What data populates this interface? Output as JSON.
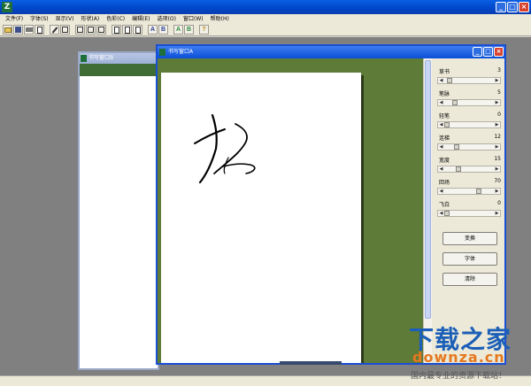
{
  "app": {
    "icon_glyph": "Z",
    "window_buttons": [
      "_",
      "□",
      "×"
    ]
  },
  "menu": [
    "文件(F)",
    "字体(S)",
    "显示(V)",
    "形状(A)",
    "色彩(C)",
    "编辑(E)",
    "选项(O)",
    "窗口(W)",
    "帮助(H)"
  ],
  "toolbar": {
    "buttons": [
      {
        "icon": "open-icon",
        "glyph": ""
      },
      {
        "icon": "save-icon",
        "glyph": ""
      },
      {
        "icon": "print-icon",
        "glyph": ""
      },
      {
        "icon": "print-preview-icon",
        "glyph": ""
      },
      {
        "icon": "pen-icon",
        "glyph": ""
      },
      {
        "icon": "window-icon",
        "glyph": ""
      },
      {
        "icon": "tile-icon",
        "glyph": ""
      },
      {
        "icon": "cascade-icon",
        "glyph": ""
      },
      {
        "icon": "arrange-icon",
        "glyph": ""
      },
      {
        "icon": "copy-icon",
        "glyph": ""
      },
      {
        "icon": "paste-icon",
        "glyph": ""
      },
      {
        "icon": "cut-icon",
        "glyph": ""
      },
      {
        "icon": "bold-a-icon",
        "glyph": "A"
      },
      {
        "icon": "bold-b-icon",
        "glyph": "B"
      },
      {
        "icon": "color-a-icon",
        "glyph": "A"
      },
      {
        "icon": "color-b-icon",
        "glyph": "B"
      },
      {
        "icon": "help-icon",
        "glyph": "?"
      }
    ]
  },
  "windows": {
    "back": {
      "title": "书写窗口B"
    },
    "front": {
      "title": "书写窗口A"
    }
  },
  "sliders": [
    {
      "label": "草书",
      "value": "3",
      "fraction": 0.05
    },
    {
      "label": "笔脉",
      "value": "5",
      "fraction": 0.18
    },
    {
      "label": "轻笔",
      "value": "0",
      "fraction": 0.0
    },
    {
      "label": "连梯",
      "value": "12",
      "fraction": 0.22
    },
    {
      "label": "宽度",
      "value": "15",
      "fraction": 0.25
    },
    {
      "label": "回场",
      "value": "70",
      "fraction": 0.72
    },
    {
      "label": "飞白",
      "value": "0",
      "fraction": 0.0
    }
  ],
  "actions": [
    "变换",
    "字体",
    "清除"
  ],
  "watermark": {
    "title": "下载之家",
    "domain": "downza.cn",
    "slogan": "国内最专业的资源下载站！"
  },
  "colors": {
    "canvas_bg": "#5f7b38",
    "title_active": "#0b4fd8",
    "watermark_blue": "#1c5fb8",
    "watermark_orange": "#e6781e"
  }
}
